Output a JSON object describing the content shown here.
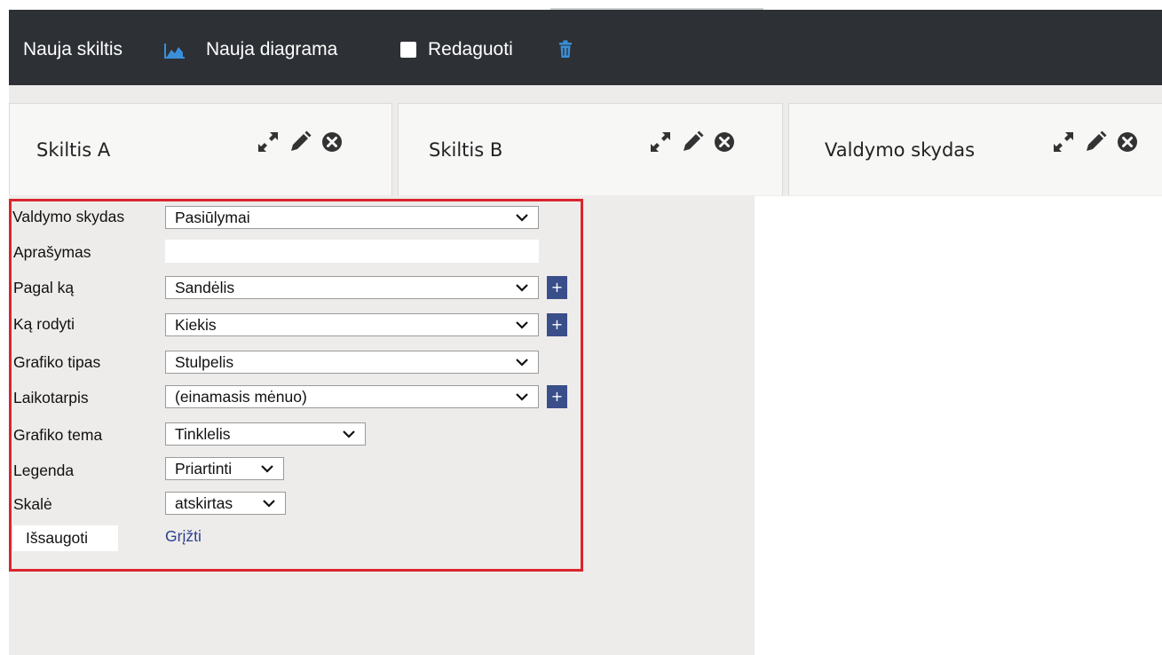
{
  "toolbar": {
    "new_column_label": "Nauja skiltis",
    "new_chart_label": "Nauja diagrama",
    "edit_label": "Redaguoti",
    "icons": [
      "area-chart-icon",
      "checkbox-icon",
      "trash-icon"
    ],
    "icon_color": "#3a8fd8"
  },
  "tabs": [
    {
      "title": "Skiltis A",
      "icons": [
        "expand-icon",
        "pencil-icon",
        "close-circle-icon"
      ]
    },
    {
      "title": "Skiltis B",
      "icons": [
        "expand-icon",
        "pencil-icon",
        "close-circle-icon"
      ]
    },
    {
      "title": "Valdymo skydas",
      "icons": [
        "expand-icon",
        "pencil-icon",
        "close-circle-icon"
      ]
    }
  ],
  "form": {
    "fields": [
      {
        "label": "Valdymo skydas",
        "type": "select",
        "value": "Pasiūlymai",
        "plus": false
      },
      {
        "label": "Aprašymas",
        "type": "text",
        "value": "",
        "plus": false
      },
      {
        "label": "Pagal ką",
        "type": "select",
        "value": "Sandėlis",
        "plus": true
      },
      {
        "label": "Ką rodyti",
        "type": "select",
        "value": "Kiekis",
        "plus": true
      },
      {
        "label": "Grafiko tipas",
        "type": "select",
        "value": "Stulpelis",
        "plus": false
      },
      {
        "label": "Laikotarpis",
        "type": "select",
        "value": "(einamasis mėnuo)",
        "plus": true
      },
      {
        "label": "Grafiko tema",
        "type": "select",
        "value": "Tinklelis",
        "plus": false
      },
      {
        "label": "Legenda",
        "type": "select",
        "value": "Priartinti",
        "plus": false
      },
      {
        "label": "Skalė",
        "type": "select",
        "value": "atskirtas",
        "plus": false
      }
    ],
    "plus_label": "+",
    "save_label": "Išsaugoti",
    "back_label": "Grįžti",
    "highlight_color": "#d9252e"
  }
}
